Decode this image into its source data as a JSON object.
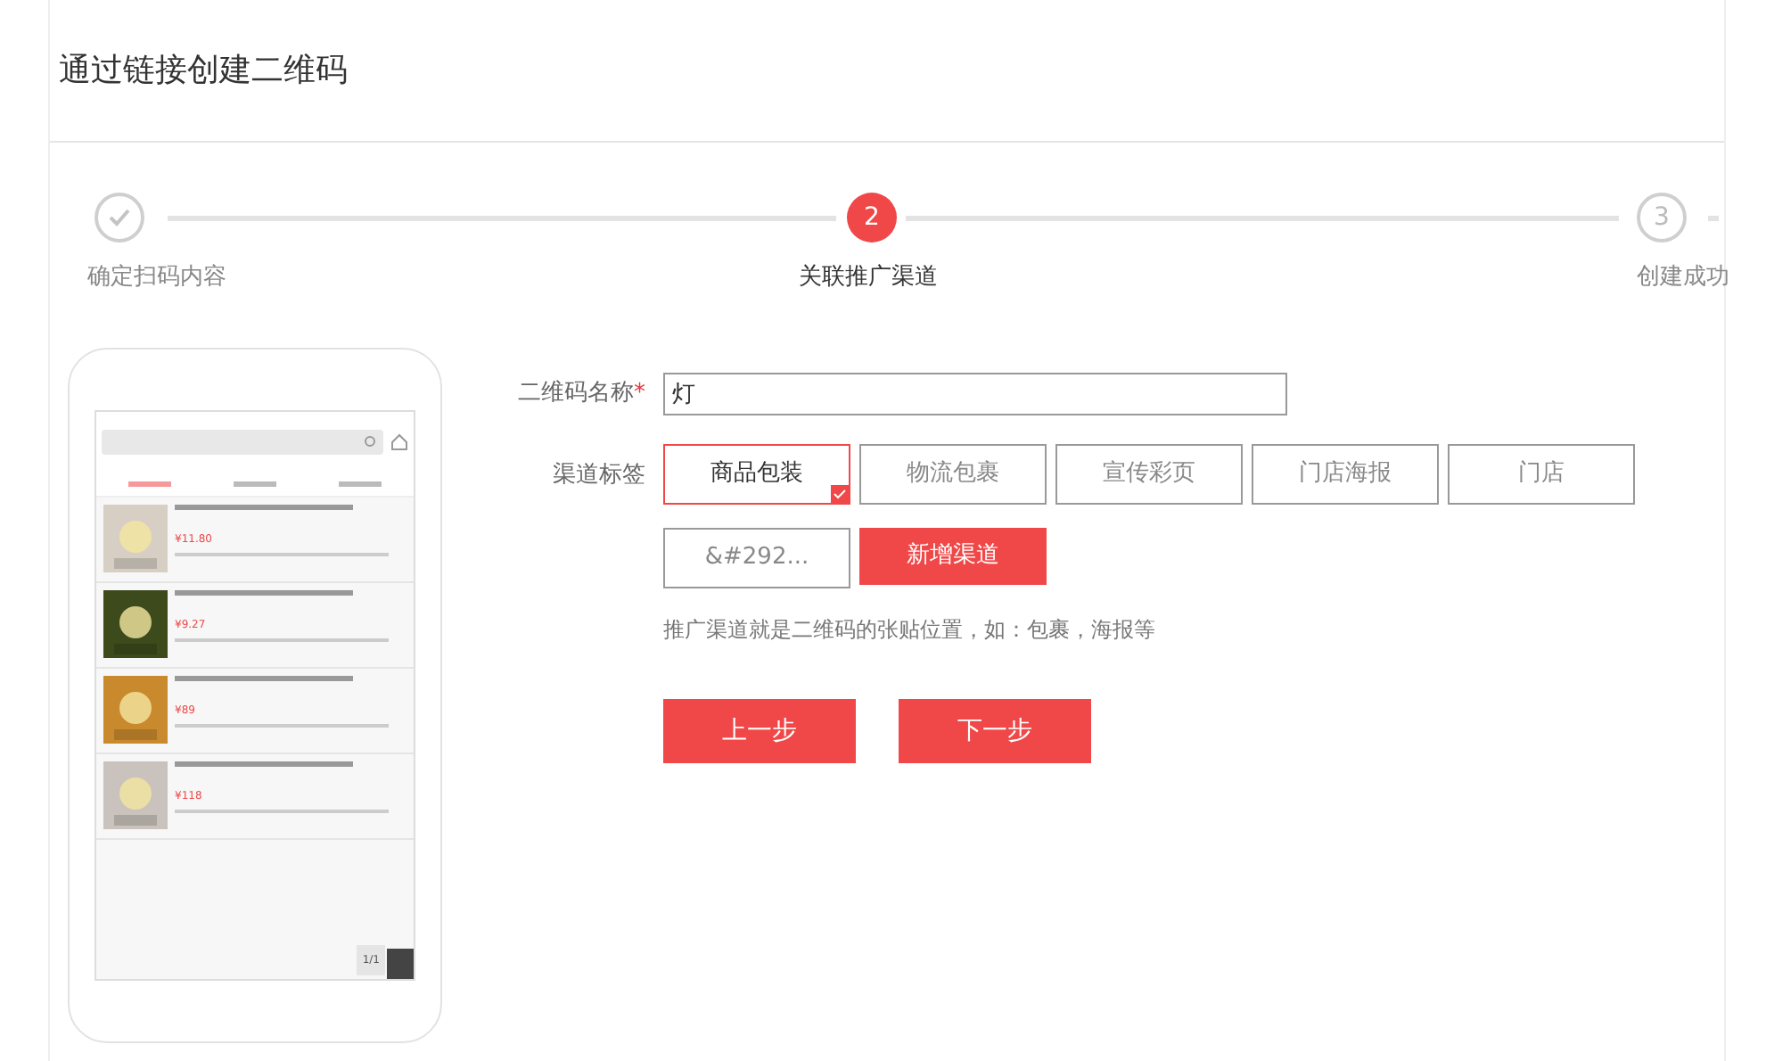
{
  "page_title": "通过链接创建二维码",
  "steps": [
    {
      "label": "确定扫码内容",
      "completed": true,
      "selected": false
    },
    {
      "number": "2",
      "label": "关联推广渠道",
      "completed": false,
      "selected": true
    },
    {
      "number": "3",
      "label": "创建成功",
      "completed": false,
      "selected": false
    }
  ],
  "preview": {
    "sort_tabs": [
      {
        "selected": true
      },
      {
        "selected": false
      },
      {
        "selected": false
      }
    ],
    "products": [
      {
        "price": "¥11.80"
      },
      {
        "price": "¥9.27"
      },
      {
        "price": "¥89"
      },
      {
        "price": "¥118"
      }
    ],
    "page_indicator": "1/1"
  },
  "form": {
    "name_label": "二维码名称",
    "required_mark": "*",
    "name_value": "灯",
    "channel_label": "渠道标签",
    "channels": [
      {
        "kind": "tag",
        "label": "商品包装",
        "selected": true
      },
      {
        "kind": "tag",
        "label": "物流包裹",
        "selected": false
      },
      {
        "kind": "tag",
        "label": "宣传彩页",
        "selected": false
      },
      {
        "kind": "tag",
        "label": "门店海报",
        "selected": false
      },
      {
        "kind": "tag",
        "label": "门店",
        "selected": false
      },
      {
        "kind": "tag",
        "label": "&#292...",
        "selected": false
      },
      {
        "kind": "add",
        "label": "新增渠道"
      }
    ],
    "hint": "推广渠道就是二维码的张贴位置，如：包裹，海报等",
    "buttons": [
      "上一步",
      "下一步"
    ]
  }
}
